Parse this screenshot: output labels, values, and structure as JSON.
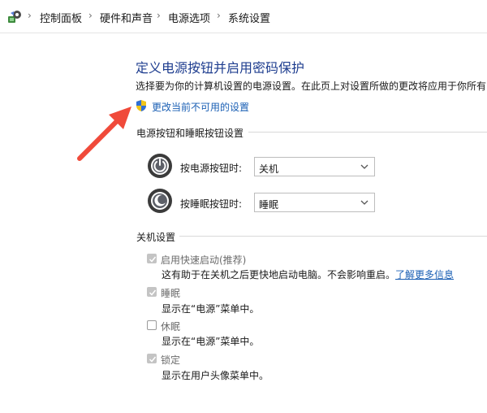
{
  "breadcrumb": {
    "items": [
      "控制面板",
      "硬件和声音",
      "电源选项",
      "系统设置"
    ],
    "separator": "›"
  },
  "main": {
    "title": "定义电源按钮并启用密码保护",
    "description": "选择要为你的计算机设置的电源设置。在此页上对设置所做的更改将应用于你所有的",
    "change_link": "更改当前不可用的设置"
  },
  "power_buttons": {
    "header": "电源按钮和睡眠按钮设置",
    "power_label": "按电源按钮时:",
    "power_value": "关机",
    "sleep_label": "按睡眠按钮时:",
    "sleep_value": "睡眠"
  },
  "shutdown": {
    "header": "关机设置",
    "options": [
      {
        "label": "启用快速启动(推荐)",
        "desc": "这有助于在关机之后更快地启动电脑。不会影响重启。",
        "link": "了解更多信息",
        "checked": true,
        "disabled": true
      },
      {
        "label": "睡眠",
        "desc": "显示在“电源”菜单中。",
        "checked": true,
        "disabled": true
      },
      {
        "label": "休眠",
        "desc": "显示在“电源”菜单中。",
        "checked": false,
        "disabled": false
      },
      {
        "label": "锁定",
        "desc": "显示在用户头像菜单中。",
        "checked": true,
        "disabled": true
      }
    ]
  },
  "colors": {
    "title_blue": "#1e3d8f",
    "link_blue": "#1a5fb4",
    "arrow_red": "#f04a3a"
  },
  "icons": [
    "control-panel-icon",
    "shield-icon",
    "power-button-icon",
    "sleep-button-icon",
    "chevron-down-icon",
    "checkmark-icon",
    "annotation-arrow"
  ]
}
